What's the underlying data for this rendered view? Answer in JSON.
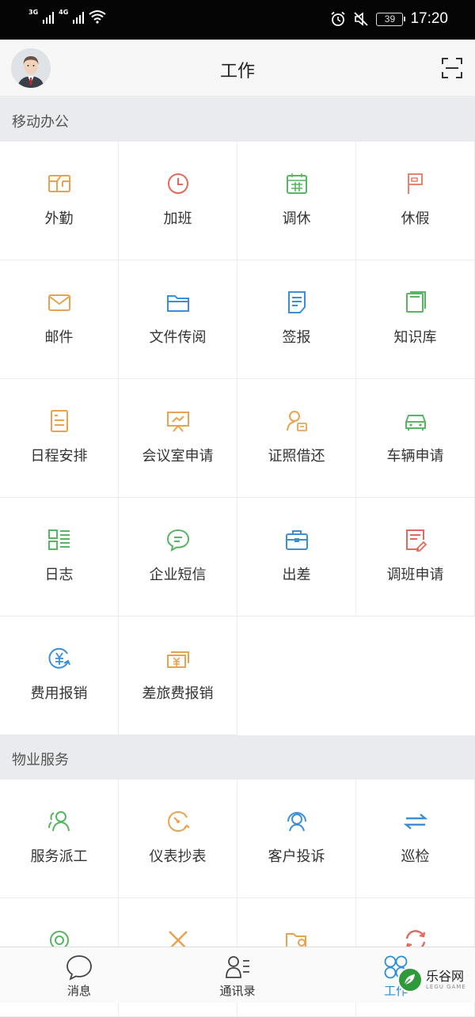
{
  "status": {
    "network1": "3G",
    "network2": "4G",
    "battery": "39",
    "time": "17:20"
  },
  "header": {
    "title": "工作"
  },
  "sections": [
    {
      "title": "移动办公",
      "items": [
        {
          "label": "外勤",
          "icon": "map-icon",
          "color": "#e8a350"
        },
        {
          "label": "加班",
          "icon": "clock-icon",
          "color": "#e06a5c"
        },
        {
          "label": "调休",
          "icon": "calendar-icon",
          "color": "#56b661"
        },
        {
          "label": "休假",
          "icon": "flag-icon",
          "color": "#e8826a"
        },
        {
          "label": "邮件",
          "icon": "mail-icon",
          "color": "#e8a350"
        },
        {
          "label": "文件传阅",
          "icon": "folder-icon",
          "color": "#3b8fd6"
        },
        {
          "label": "签报",
          "icon": "document-icon",
          "color": "#3b8fd6"
        },
        {
          "label": "知识库",
          "icon": "book-icon",
          "color": "#56b661"
        },
        {
          "label": "日程安排",
          "icon": "list-doc-icon",
          "color": "#e8a350"
        },
        {
          "label": "会议室申请",
          "icon": "presentation-icon",
          "color": "#e8a350"
        },
        {
          "label": "证照借还",
          "icon": "person-card-icon",
          "color": "#e8a350"
        },
        {
          "label": "车辆申请",
          "icon": "car-icon",
          "color": "#56b661"
        },
        {
          "label": "日志",
          "icon": "log-grid-icon",
          "color": "#56b661"
        },
        {
          "label": "企业短信",
          "icon": "chat-bubble-icon",
          "color": "#56b661"
        },
        {
          "label": "出差",
          "icon": "briefcase-icon",
          "color": "#3b8fd6"
        },
        {
          "label": "调班申请",
          "icon": "edit-doc-icon",
          "color": "#e06a5c"
        },
        {
          "label": "费用报销",
          "icon": "yen-refresh-icon",
          "color": "#3b8fd6"
        },
        {
          "label": "差旅费报销",
          "icon": "money-icon",
          "color": "#e8a350"
        }
      ]
    },
    {
      "title": "物业服务",
      "items": [
        {
          "label": "服务派工",
          "icon": "people-icon",
          "color": "#56b661"
        },
        {
          "label": "仪表抄表",
          "icon": "gauge-icon",
          "color": "#e8a350"
        },
        {
          "label": "客户投诉",
          "icon": "headset-icon",
          "color": "#3b8fd6"
        },
        {
          "label": "巡检",
          "icon": "swap-arrows-icon",
          "color": "#3b8fd6"
        },
        {
          "label": "",
          "icon": "target-icon",
          "color": "#56b661"
        },
        {
          "label": "",
          "icon": "tools-icon",
          "color": "#e8a350"
        },
        {
          "label": "",
          "icon": "folder-search-icon",
          "color": "#e8a350"
        },
        {
          "label": "",
          "icon": "refresh-icon",
          "color": "#e06a5c"
        }
      ]
    }
  ],
  "tabs": [
    {
      "label": "消息",
      "icon": "message-icon",
      "active": false
    },
    {
      "label": "通讯录",
      "icon": "contacts-icon",
      "active": false
    },
    {
      "label": "工作",
      "icon": "clover-icon",
      "active": true
    }
  ],
  "watermark": {
    "text": "乐谷网",
    "sub": "LEGU GAME"
  }
}
